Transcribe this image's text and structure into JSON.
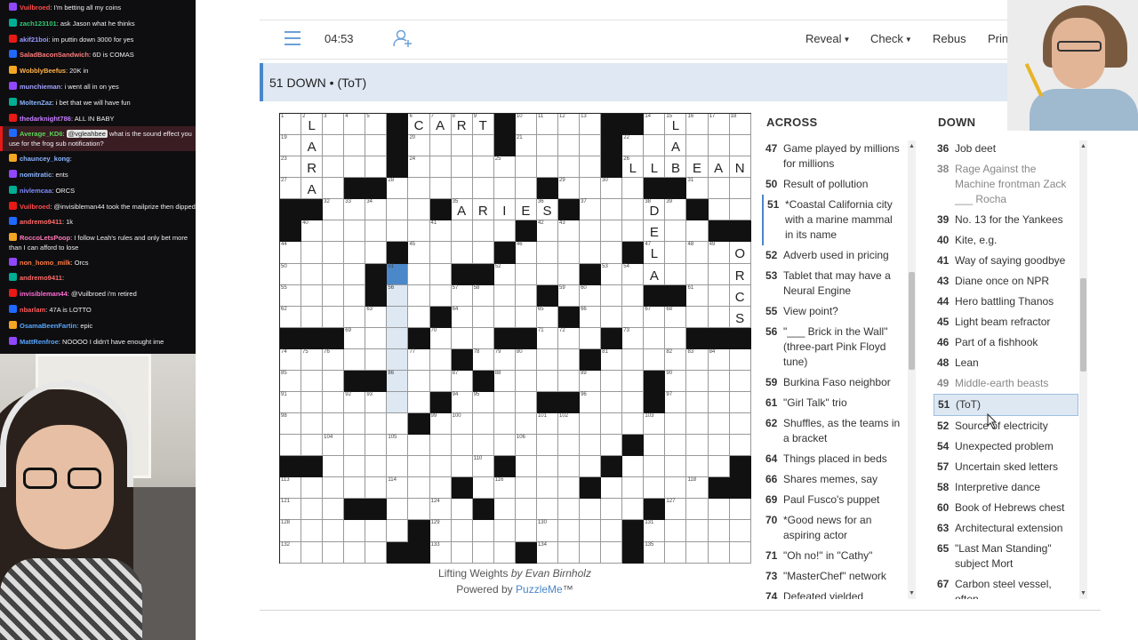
{
  "chat": {
    "messages": [
      {
        "user": "Vuilbroed",
        "text": "I'm betting all my coins",
        "color": "#ff4a4a"
      },
      {
        "user": "zach123101",
        "text": "ask Jason what he thinks",
        "color": "#2ecc71"
      },
      {
        "user": "akif21boi",
        "text": "im puttin down 3000 for yes",
        "color": "#9b9bff"
      },
      {
        "user": "SaladBaconSandwich",
        "text": "6D is COMAS",
        "color": "#ff7a7a"
      },
      {
        "user": "WobblyBeefus",
        "text": "20K in",
        "color": "#ffb347"
      },
      {
        "user": "munchieman",
        "text": "i went all in on yes",
        "color": "#a0a0ff"
      },
      {
        "user": "MoltenZaz",
        "text": "i bet that we will have fun",
        "color": "#8ab4ff"
      },
      {
        "user": "thedarknight786",
        "text": "ALL IN BABY",
        "color": "#c77dff"
      },
      {
        "user": "Average_KD6",
        "mention": "@vgleahbee",
        "text": "what is the sound effect you use for the frog sub notification?",
        "color": "#5bd45b",
        "highlight": true
      },
      {
        "user": "chauncey_kong",
        "text": "",
        "color": "#8ab4ff"
      },
      {
        "user": "nomitratic",
        "text": "ents",
        "color": "#8ab4ff"
      },
      {
        "user": "nivlemcaa",
        "text": "ORCS",
        "color": "#7f8cff"
      },
      {
        "user": "Vuilbroed",
        "text": "@invisibleman44 took the mailprize then dipped",
        "color": "#ff4a4a"
      },
      {
        "user": "andremo9411",
        "text": "1k",
        "color": "#ff6b6b"
      },
      {
        "user": "RoccoLetsPoop",
        "text": "I follow Leah's rules and only bet more than I can afford to lose",
        "color": "#ff7ab8"
      },
      {
        "user": "non_homo_milk",
        "text": "Orcs",
        "color": "#ff7a45"
      },
      {
        "user": "andremo9411",
        "text": "",
        "color": "#ff6b6b"
      },
      {
        "user": "invisibleman44",
        "text": "@Vuilbroed i'm retired",
        "color": "#ff6bd6"
      },
      {
        "user": "nbarlam",
        "text": "47A is LOTTO",
        "color": "#ff5a5a"
      },
      {
        "user": "OsamaBeenFartin",
        "text": "epic",
        "color": "#58a6ff"
      },
      {
        "user": "MattRenfroe",
        "text": "NOOOO I didn't have enought ime",
        "color": "#58a6ff"
      }
    ]
  },
  "toolbar": {
    "timer": "04:53",
    "reveal": "Reveal",
    "check": "Check",
    "rebus": "Rebus",
    "print": "Print"
  },
  "current_clue": "51 DOWN • (ToT)",
  "grid": {
    "cols": 22,
    "rows": 21,
    "black": [
      "0,5",
      "0,10",
      "0,15",
      "0,16",
      "1,5",
      "1,10",
      "1,15",
      "2,5",
      "2,15",
      "3,3",
      "3,4",
      "3,12",
      "3,17",
      "3,18",
      "4,0",
      "4,1",
      "4,7",
      "4,13",
      "4,19",
      "5,0",
      "5,11",
      "5,20",
      "5,21",
      "6,5",
      "6,10",
      "6,16",
      "7,4",
      "7,8",
      "7,9",
      "7,14",
      "8,4",
      "8,12",
      "8,17",
      "8,18",
      "9,7",
      "9,13",
      "10,0",
      "10,1",
      "10,2",
      "10,6",
      "10,10",
      "10,11",
      "10,15",
      "10,19",
      "10,20",
      "10,21",
      "11,8",
      "11,14",
      "12,3",
      "12,4",
      "12,9",
      "12,17",
      "13,7",
      "13,12",
      "13,13",
      "13,17",
      "14,6",
      "15,16",
      "16,0",
      "16,1",
      "16,10",
      "16,15",
      "16,21",
      "17,8",
      "17,14",
      "17,20",
      "17,21",
      "18,3",
      "18,4",
      "18,9",
      "18,17",
      "19,6",
      "19,16",
      "20,5",
      "20,6",
      "20,11",
      "20,16"
    ],
    "numbers": {
      "0,0": "1",
      "0,1": "2",
      "0,2": "3",
      "0,3": "4",
      "0,4": "5",
      "0,6": "6",
      "0,7": "7",
      "0,8": "8",
      "0,9": "9",
      "0,11": "10",
      "0,12": "11",
      "0,13": "12",
      "0,14": "13",
      "0,17": "14",
      "0,18": "15",
      "0,19": "16",
      "0,20": "17",
      "0,21": "18",
      "1,0": "19",
      "1,6": "20",
      "1,11": "21",
      "1,16": "22",
      "2,0": "23",
      "2,6": "24",
      "2,10": "25",
      "2,16": "26",
      "3,0": "27",
      "3,5": "28",
      "3,13": "29",
      "3,15": "30",
      "3,19": "31",
      "4,2": "32",
      "4,3": "33",
      "4,4": "34",
      "4,8": "35",
      "4,12": "36",
      "4,14": "37",
      "4,17": "38",
      "4,18": "39",
      "5,1": "40",
      "5,7": "41",
      "5,12": "42",
      "5,13": "43",
      "6,0": "44",
      "6,6": "45",
      "6,11": "46",
      "6,17": "47",
      "6,19": "48",
      "6,20": "49",
      "7,0": "50",
      "7,5": "51",
      "7,10": "52",
      "7,15": "53",
      "7,16": "54",
      "8,0": "55",
      "8,5": "56",
      "8,8": "57",
      "8,9": "58",
      "8,13": "59",
      "8,14": "60",
      "8,19": "61",
      "9,0": "62",
      "9,4": "63",
      "9,8": "64",
      "9,12": "65",
      "9,14": "66",
      "9,17": "67",
      "9,18": "68",
      "10,3": "69",
      "10,7": "70",
      "10,12": "71",
      "10,13": "72",
      "10,16": "73",
      "11,0": "74",
      "11,1": "75",
      "11,2": "76",
      "11,6": "77",
      "11,9": "78",
      "11,10": "79",
      "11,11": "80",
      "11,15": "81",
      "11,18": "82",
      "11,19": "83",
      "11,20": "84",
      "12,0": "85",
      "12,5": "86",
      "12,8": "87",
      "12,10": "88",
      "12,14": "89",
      "12,18": "90",
      "13,0": "91",
      "13,3": "92",
      "13,4": "93",
      "13,8": "94",
      "13,9": "95",
      "13,14": "96",
      "13,18": "97",
      "14,0": "98",
      "14,7": "99",
      "14,8": "100",
      "14,12": "101",
      "14,13": "102",
      "14,17": "103",
      "15,2": "104",
      "15,5": "105",
      "15,11": "106",
      "15,16": "107",
      "16,0": "108",
      "16,1": "109",
      "16,9": "110",
      "16,10": "111",
      "16,15": "112",
      "17,0": "113",
      "17,5": "114",
      "17,8": "115",
      "17,10": "116",
      "17,14": "117",
      "17,19": "118",
      "17,20": "119",
      "17,21": "120",
      "18,0": "121",
      "18,3": "122",
      "18,4": "123",
      "18,7": "124",
      "18,9": "125",
      "18,17": "126",
      "18,18": "127",
      "19,0": "128",
      "19,7": "129",
      "19,12": "130",
      "19,17": "131",
      "20,0": "132",
      "20,7": "133",
      "20,12": "134",
      "20,17": "135"
    },
    "letters": {
      "0,1": "L",
      "1,1": "A",
      "2,1": "R",
      "3,1": "A",
      "0,6": "C",
      "0,7": "A",
      "0,8": "R",
      "0,9": "T",
      "0,18": "L",
      "1,18": "A",
      "2,18": "B",
      "2,16": "L",
      "2,17": "L",
      "2,19": "E",
      "2,20": "A",
      "2,21": "N",
      "4,8": "A",
      "4,9": "R",
      "4,10": "I",
      "4,11": "E",
      "4,12": "S",
      "4,17": "D",
      "5,17": "E",
      "6,17": "L",
      "7,17": "A",
      "6,21": "O",
      "7,21": "R",
      "8,21": "C",
      "9,21": "S"
    },
    "selected": "7,5",
    "highlighted": [
      "8,5",
      "9,5",
      "10,5",
      "11,5",
      "12,5",
      "13,5"
    ]
  },
  "byline": {
    "title": "Lifting Weights",
    "by": "by",
    "author": "Evan Birnholz",
    "powered_prefix": "Powered by",
    "powered_name": "PuzzleMe",
    "tm": "™"
  },
  "across": {
    "heading": "ACROSS",
    "clues": [
      {
        "num": "47",
        "text": "Game played by millions for millions"
      },
      {
        "num": "50",
        "text": "Result of pollution"
      },
      {
        "num": "51",
        "text": "*Coastal California city with a marine mammal in its name",
        "current": true
      },
      {
        "num": "52",
        "text": "Adverb used in pricing"
      },
      {
        "num": "53",
        "text": "Tablet that may have a Neural Engine"
      },
      {
        "num": "55",
        "text": "View point?"
      },
      {
        "num": "56",
        "text": "\"___ Brick in the Wall\" (three-part Pink Floyd tune)"
      },
      {
        "num": "59",
        "text": "Burkina Faso neighbor"
      },
      {
        "num": "61",
        "text": "\"Girl Talk\" trio"
      },
      {
        "num": "62",
        "text": "Shuffles, as the teams in a bracket"
      },
      {
        "num": "64",
        "text": "Things placed in beds"
      },
      {
        "num": "66",
        "text": "Shares memes, say"
      },
      {
        "num": "69",
        "text": "Paul Fusco's puppet"
      },
      {
        "num": "70",
        "text": "*Good news for an aspiring actor"
      },
      {
        "num": "71",
        "text": "\"Oh no!\" in \"Cathy\""
      },
      {
        "num": "73",
        "text": "\"MasterChef\" network"
      },
      {
        "num": "74",
        "text": "Defeated yielded"
      }
    ]
  },
  "down": {
    "heading": "DOWN",
    "clues": [
      {
        "num": "36",
        "text": "Job deet"
      },
      {
        "num": "38",
        "text": "Rage Against the Machine frontman Zack ___ Rocha",
        "dim": true
      },
      {
        "num": "39",
        "text": "No. 13 for the Yankees"
      },
      {
        "num": "40",
        "text": "Kite, e.g."
      },
      {
        "num": "41",
        "text": "Way of saying goodbye"
      },
      {
        "num": "43",
        "text": "Diane once on NPR"
      },
      {
        "num": "44",
        "text": "Hero battling Thanos"
      },
      {
        "num": "45",
        "text": "Light beam refractor"
      },
      {
        "num": "46",
        "text": "Part of a fishhook"
      },
      {
        "num": "48",
        "text": "Lean"
      },
      {
        "num": "49",
        "text": "Middle-earth beasts",
        "dim": true
      },
      {
        "num": "51",
        "text": "(ToT)",
        "selected": true
      },
      {
        "num": "52",
        "text": "Source of electricity"
      },
      {
        "num": "54",
        "text": "Unexpected problem"
      },
      {
        "num": "57",
        "text": "Uncertain sked letters"
      },
      {
        "num": "58",
        "text": "Interpretive dance"
      },
      {
        "num": "60",
        "text": "Book of Hebrews chest"
      },
      {
        "num": "63",
        "text": "Architectural extension"
      },
      {
        "num": "65",
        "text": "\"Last Man Standing\" subject Mort"
      },
      {
        "num": "67",
        "text": "Carbon steel vessel, often"
      }
    ]
  },
  "colors": {
    "accent": "#4a87c8",
    "highlight": "#dde8f3",
    "selected_cell": "#4b88c9"
  }
}
